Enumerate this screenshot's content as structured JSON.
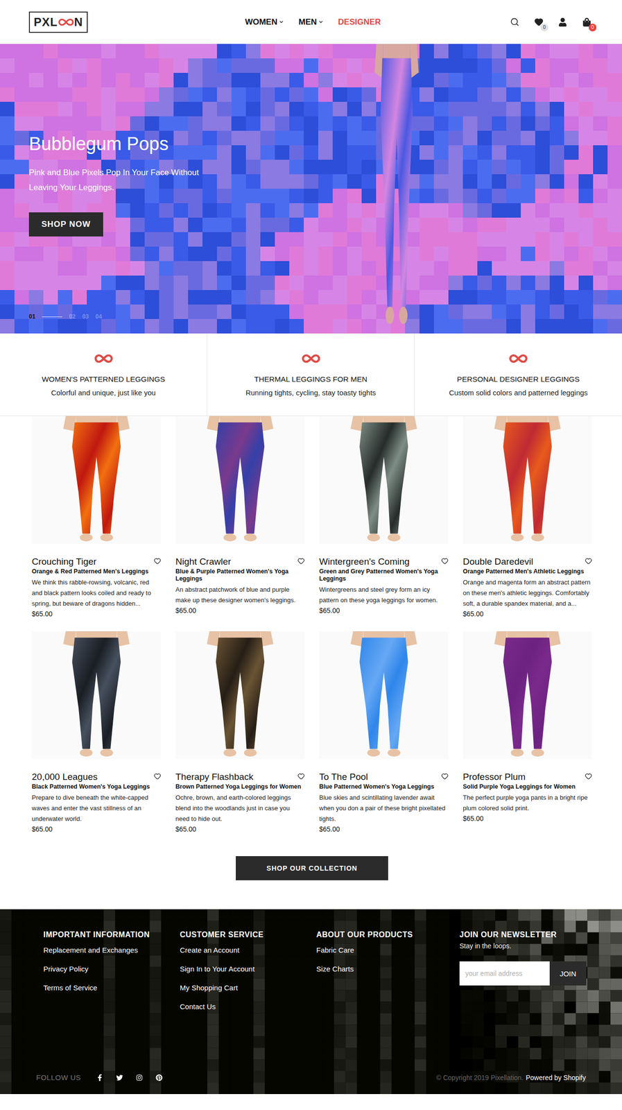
{
  "header": {
    "logo": {
      "before": "PXL",
      "after": "N"
    },
    "nav": [
      {
        "label": "WOMEN",
        "dropdown": true,
        "highlighted": false
      },
      {
        "label": "MEN",
        "dropdown": true,
        "highlighted": false
      },
      {
        "label": "DESIGNER",
        "dropdown": false,
        "highlighted": true
      }
    ],
    "wishlist_count": "0",
    "cart_count": "0"
  },
  "hero": {
    "title": "Bubblegum Pops",
    "subtitle": "Pink and Blue Pixels Pop In Your Face Without Leaving Your Leggings.",
    "button": "SHOP NOW",
    "slides": [
      {
        "label": "01",
        "selected": true
      },
      {
        "label": "02",
        "selected": false
      },
      {
        "label": "03",
        "selected": false
      },
      {
        "label": "04",
        "selected": false
      }
    ]
  },
  "features": [
    {
      "title": "WOMEN'S PATTERNED LEGGINGS",
      "subtitle": "Colorful and unique, just like you"
    },
    {
      "title": "THERMAL LEGGINGS FOR MEN",
      "subtitle": "Running tights, cycling, stay toasty tights"
    },
    {
      "title": "PERSONAL DESIGNER LEGGINGS",
      "subtitle": "Custom solid colors and patterned leggings"
    }
  ],
  "products": [
    {
      "name": "Crouching Tiger",
      "type": "Orange & Red Patterned Men's Leggings",
      "description": "We think this rabble-rowsing, volcanic, red and black pattern looks coiled and ready to spring, but beware of dragons hidden...",
      "price": "$65.00",
      "color": "#f27010",
      "accent_color": "#c01810",
      "wishlisted": false
    },
    {
      "name": "Night Crawler",
      "type": "Blue & Purple Patterned Women's Yoga Leggings",
      "description": "An abstract patchwork of blue and purple make up these designer women's leggings.",
      "price": "$65.00",
      "color": "#3440a8",
      "accent_color": "#7a3a8c",
      "wishlisted": false
    },
    {
      "name": "Wintergreen's Coming",
      "type": "Green and Grey Patterned Women's Yoga Leggings",
      "description": "Wintergreens and steel grey form an icy pattern on these yoga leggings for women.",
      "price": "$65.00",
      "color": "#7e8e86",
      "accent_color": "#262c2a",
      "wishlisted": false
    },
    {
      "name": "Double Daredevil",
      "type": "Orange Patterned Men's Athletic Leggings",
      "description": "Orange and magenta form an abstract pattern on these men's athletic leggings. Comfortably soft, a durable spandex material, and a...",
      "price": "$65.00",
      "color": "#e85a1c",
      "accent_color": "#c02a34",
      "wishlisted": false
    },
    {
      "name": "20,000 Leagues",
      "type": "Black Patterned Women's Yoga Leggings",
      "description": "Prepare to dive beneath the white-capped waves and enter the vast stillness of an underwater world.",
      "price": "$65.00",
      "color": "#46505e",
      "accent_color": "#1a1e24",
      "wishlisted": false
    },
    {
      "name": "Therapy Flashback",
      "type": "Brown Patterned Yoga Leggings for Women",
      "description": "Ochre, brown, and earth-colored leggings blend into the woodlands just in case you need to hide out.",
      "price": "$65.00",
      "color": "#6a5434",
      "accent_color": "#261e16",
      "wishlisted": false
    },
    {
      "name": "To The Pool",
      "type": "Blue Patterned Women's Yoga Leggings",
      "description": "Blue skies and scintillating lavender await when you don a pair of these bright pixellated tights.",
      "price": "$65.00",
      "color": "#2f86ea",
      "accent_color": "#66a8f4",
      "wishlisted": false
    },
    {
      "name": "Professor Plum",
      "type": "Solid Purple Yoga Leggings for Women",
      "description": "The perfect purple yoga pants in a bright ripe plum colored solid print.",
      "price": "$65.00",
      "color": "#7a2a8c",
      "accent_color": "#6c2280",
      "wishlisted": false
    }
  ],
  "collection_button": "SHOP OUR COLLECTION",
  "footer": {
    "columns": [
      {
        "title": "IMPORTANT INFORMATION",
        "links": [
          "Replacement and Exchanges",
          "Privacy Policy",
          "Terms of Service"
        ]
      },
      {
        "title": "CUSTOMER SERVICE",
        "links": [
          "Create an Account",
          "Sign In to Your Account",
          "My Shopping Cart",
          "Contact Us"
        ]
      },
      {
        "title": "ABOUT OUR PRODUCTS",
        "links": [
          "Fabric Care",
          "Size Charts"
        ]
      }
    ],
    "newsletter": {
      "title": "JOIN OUR NEWSLETTER",
      "subtitle": "Stay in the loops.",
      "placeholder": "your email address",
      "button": "JOIN"
    },
    "follow": "FOLLOW US",
    "copyright": "© Copyright 2019 Pixellation.",
    "powered": "Powered by Shopify"
  }
}
